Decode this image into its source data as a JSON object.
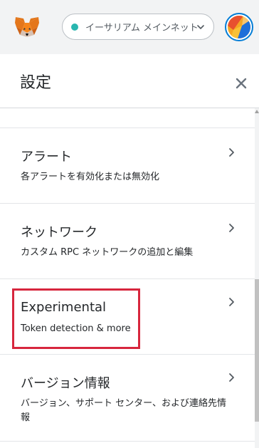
{
  "header": {
    "network_label": "イーサリアム メインネット",
    "network_color": "#29b6af"
  },
  "settings": {
    "title": "設定"
  },
  "items": [
    {
      "title": "アラート",
      "description": "各アラートを有効化または無効化"
    },
    {
      "title": "ネットワーク",
      "description": "カスタム RPC ネットワークの追加と編集"
    },
    {
      "title": "Experimental",
      "description": "Token detection & more"
    },
    {
      "title": "バージョン情報",
      "description": "バージョン、サポート センター、および連絡先情報"
    }
  ],
  "icons": {
    "logo": "metamask-fox-icon",
    "network_dropdown": "chevron-down-icon",
    "close": "close-icon",
    "row": "chevron-right-icon",
    "account": "account-avatar"
  },
  "colors": {
    "highlight": "#d7263d",
    "avatar_ring": "#037dd6"
  }
}
